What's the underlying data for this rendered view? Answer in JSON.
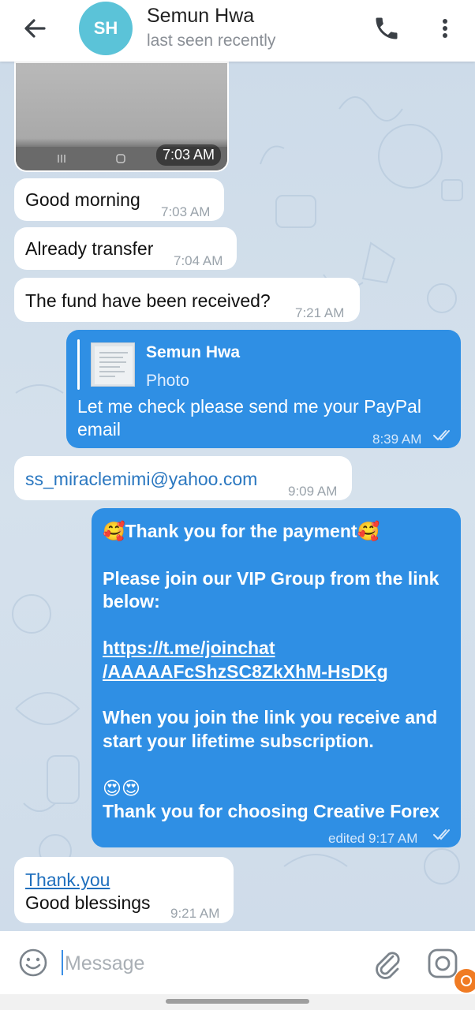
{
  "header": {
    "avatar_initials": "SH",
    "avatar_color": "#5bc3d8",
    "name": "Semun Hwa",
    "status": "last seen recently"
  },
  "messages": [
    {
      "type": "photo",
      "direction": "incoming",
      "time": "7:03 AM"
    },
    {
      "type": "text",
      "direction": "incoming",
      "text": "Good morning",
      "time": "7:03 AM"
    },
    {
      "type": "text",
      "direction": "incoming",
      "text": "Already transfer",
      "time": "7:04 AM"
    },
    {
      "type": "text",
      "direction": "incoming",
      "text": "The fund have been received?",
      "time": "7:21 AM"
    },
    {
      "type": "reply",
      "direction": "outgoing",
      "reply_to_name": "Semun Hwa",
      "reply_to_label": "Photo",
      "line1": "Let me check please send me your PayPal",
      "line2": "email",
      "time": "8:39 AM"
    },
    {
      "type": "text",
      "direction": "incoming",
      "text": "ss_miraclemimi@yahoo.com",
      "time": "9:09 AM"
    },
    {
      "type": "rich",
      "direction": "outgoing",
      "line1": "🥰Thank you for the payment🥰",
      "line2": "Please join our VIP Group from the link",
      "line3": "below:",
      "link_line1": "https://t.me/joinchat",
      "link_line2": "/AAAAAFcShzSC8ZkXhM-HsDKg",
      "line4": "When you join the link you receive and",
      "line5": "start your lifetime subscription.",
      "line6": "😍😍",
      "line7": "Thank you for choosing Creative Forex",
      "time": "edited 9:17 AM"
    },
    {
      "type": "text",
      "direction": "incoming",
      "link": "Thank.you",
      "text": "Good blessings",
      "time": "9:21 AM"
    }
  ],
  "composer": {
    "placeholder": "Message"
  },
  "colors": {
    "outgoing_bubble": "#2f8fe4",
    "incoming_bubble": "#ffffff",
    "chat_background": "#cfdcea",
    "badge": "#f07b23"
  },
  "icons": [
    "back-arrow-icon",
    "phone-icon",
    "more-vertical-icon",
    "emoji-icon",
    "paperclip-icon",
    "camera-icon",
    "double-check-icon"
  ]
}
